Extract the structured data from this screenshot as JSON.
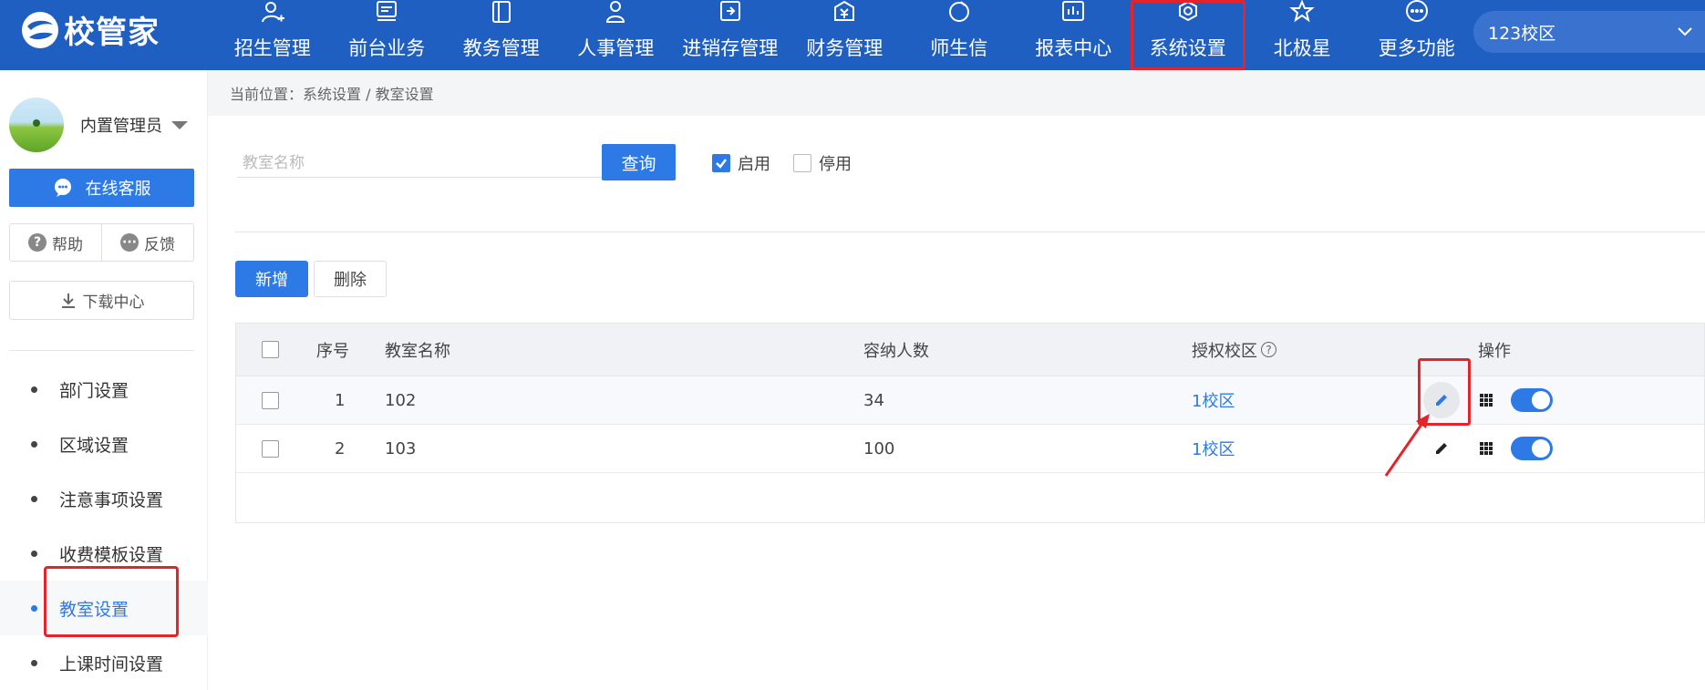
{
  "colors": {
    "brand": "#1f5fc2",
    "primary": "#2d7ae6",
    "highlight": "#e4232a"
  },
  "header": {
    "logo_text": "校管家",
    "nav": [
      {
        "label": "招生管理",
        "icon": "user-add-icon"
      },
      {
        "label": "前台业务",
        "icon": "desk-icon"
      },
      {
        "label": "教务管理",
        "icon": "book-icon"
      },
      {
        "label": "人事管理",
        "icon": "person-icon"
      },
      {
        "label": "进销存管理",
        "icon": "inventory-icon"
      },
      {
        "label": "财务管理",
        "icon": "finance-icon"
      },
      {
        "label": "师生信",
        "icon": "message-icon"
      },
      {
        "label": "报表中心",
        "icon": "report-icon"
      },
      {
        "label": "系统设置",
        "icon": "settings-icon",
        "highlighted": true
      },
      {
        "label": "北极星",
        "icon": "star-icon"
      },
      {
        "label": "更多功能",
        "icon": "more-icon"
      }
    ],
    "campus": "123校区"
  },
  "sidebar": {
    "user_name": "内置管理员",
    "service_label": "在线客服",
    "help_label": "帮助",
    "feedback_label": "反馈",
    "download_label": "下载中心",
    "menu": [
      {
        "label": "部门设置",
        "active": false
      },
      {
        "label": "区域设置",
        "active": false
      },
      {
        "label": "注意事项设置",
        "active": false
      },
      {
        "label": "收费模板设置",
        "active": false
      },
      {
        "label": "教室设置",
        "active": true
      },
      {
        "label": "上课时间设置",
        "active": false
      }
    ]
  },
  "main": {
    "breadcrumb": "当前位置：系统设置 / 教室设置",
    "search_placeholder": "教室名称",
    "query_label": "查询",
    "filter_enabled_label": "启用",
    "filter_enabled_checked": true,
    "filter_disabled_label": "停用",
    "filter_disabled_checked": false,
    "add_label": "新增",
    "delete_label": "删除",
    "table": {
      "headers": {
        "index": "序号",
        "name": "教室名称",
        "capacity": "容纳人数",
        "campus": "授权校区",
        "ops": "操作"
      },
      "rows": [
        {
          "index": "1",
          "name": "102",
          "capacity": "34",
          "campus": "1校区",
          "enabled": true
        },
        {
          "index": "2",
          "name": "103",
          "capacity": "100",
          "campus": "1校区",
          "enabled": true
        }
      ]
    }
  }
}
